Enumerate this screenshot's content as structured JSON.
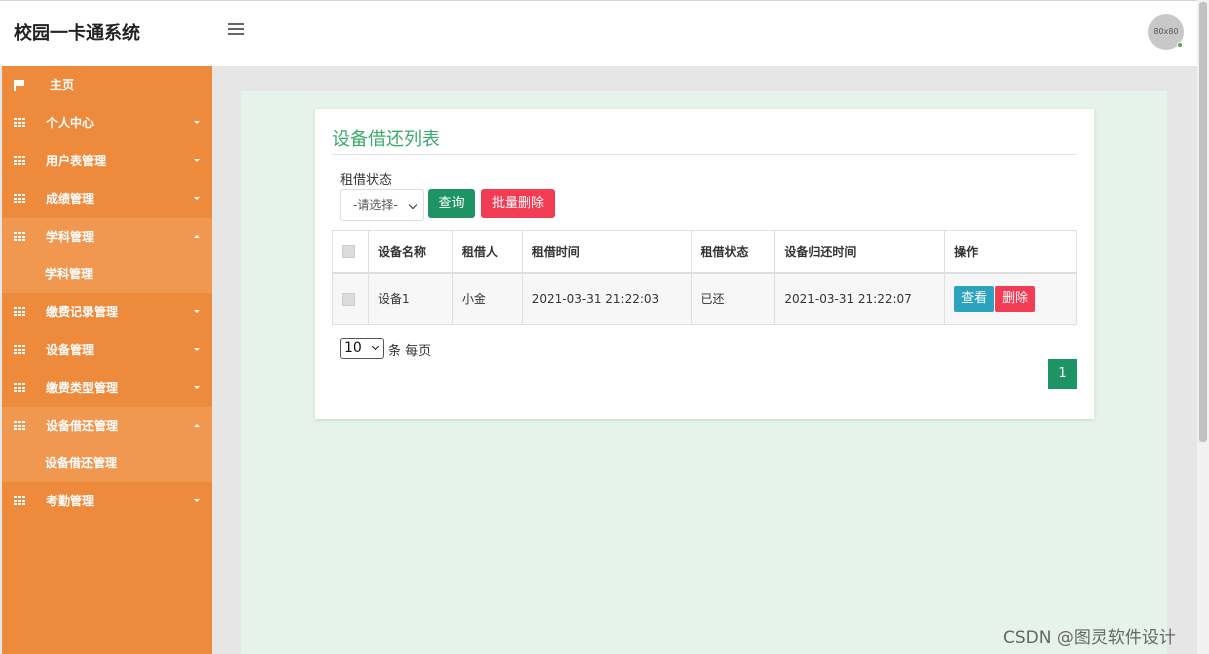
{
  "header": {
    "brand": "校园一卡通系统",
    "avatar_text": "80x80"
  },
  "sidebar": {
    "items": [
      {
        "label": "主页",
        "icon": "flag-icon"
      },
      {
        "label": "个人中心",
        "icon": "grid-icon"
      },
      {
        "label": "用户表管理",
        "icon": "grid-icon"
      },
      {
        "label": "成绩管理",
        "icon": "grid-icon"
      },
      {
        "label": "学科管理",
        "icon": "grid-icon",
        "sub": "学科管理"
      },
      {
        "label": "缴费记录管理",
        "icon": "grid-icon"
      },
      {
        "label": "设备管理",
        "icon": "grid-icon"
      },
      {
        "label": "缴费类型管理",
        "icon": "grid-icon"
      },
      {
        "label": "设备借还管理",
        "icon": "grid-icon",
        "sub": "设备借还管理"
      },
      {
        "label": "考勤管理",
        "icon": "grid-icon"
      }
    ]
  },
  "main": {
    "title": "设备借还列表",
    "filter": {
      "label": "租借状态",
      "select_value": "-请选择-",
      "query_label": "查询",
      "batch_delete_label": "批量删除"
    },
    "table": {
      "columns": [
        "设备名称",
        "租借人",
        "租借时间",
        "租借状态",
        "设备归还时间",
        "操作"
      ],
      "rows": [
        {
          "name": "设备1",
          "borrower": "小金",
          "borrow_time": "2021-03-31 21:22:03",
          "status": "已还",
          "return_time": "2021-03-31 21:22:07",
          "view": "查看",
          "delete": "删除"
        }
      ]
    },
    "pagination": {
      "page_size": "10",
      "page_size_label": "条 每页",
      "current_page": "1"
    }
  },
  "watermark": "CSDN @图灵软件设计",
  "colors": {
    "sidebar": "#ee8a3c",
    "sidebar_active": "#f09750",
    "accent_green": "#1e9464",
    "danger": "#f23c53",
    "info": "#2ba3bd",
    "title_green": "#3aab6c"
  }
}
